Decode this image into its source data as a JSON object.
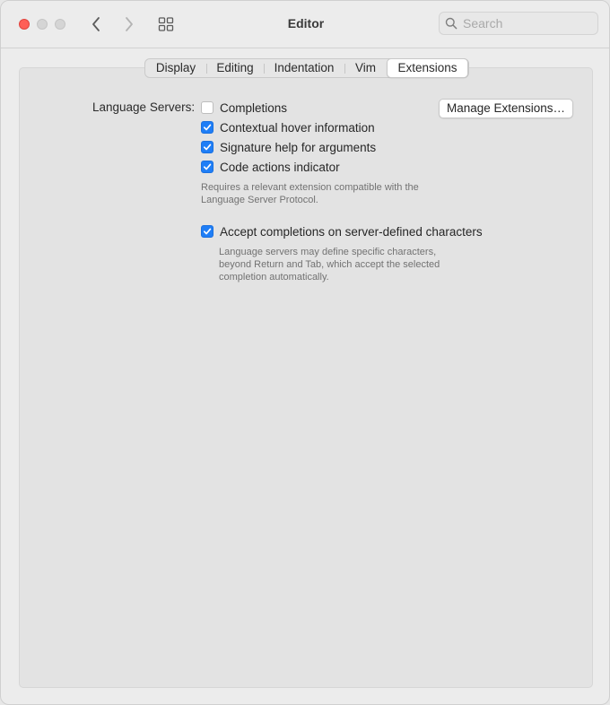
{
  "window": {
    "title": "Editor"
  },
  "toolbar": {
    "search_placeholder": "Search"
  },
  "tabs": [
    {
      "label": "Display",
      "active": false
    },
    {
      "label": "Editing",
      "active": false
    },
    {
      "label": "Indentation",
      "active": false
    },
    {
      "label": "Vim",
      "active": false
    },
    {
      "label": "Extensions",
      "active": true
    }
  ],
  "language_servers": {
    "label": "Language Servers:",
    "options": [
      {
        "label": "Completions",
        "checked": false
      },
      {
        "label": "Contextual hover information",
        "checked": true
      },
      {
        "label": "Signature help for arguments",
        "checked": true
      },
      {
        "label": "Code actions indicator",
        "checked": true
      }
    ],
    "help": "Requires a relevant extension compatible with the\nLanguage Server Protocol.",
    "manage_button": "Manage Extensions…"
  },
  "accept_completions": {
    "label": "Accept completions on server-defined characters",
    "checked": true,
    "help": "Language servers may define specific characters,\nbeyond Return and Tab, which accept the selected\ncompletion automatically."
  },
  "colors": {
    "accent": "#1f7ef6",
    "close_button": "#fe5f57"
  },
  "icons": {
    "back": "chevron-left-icon",
    "forward": "chevron-right-icon",
    "grid": "grid-icon",
    "search": "magnifying-glass-icon",
    "check": "checkmark-icon"
  }
}
